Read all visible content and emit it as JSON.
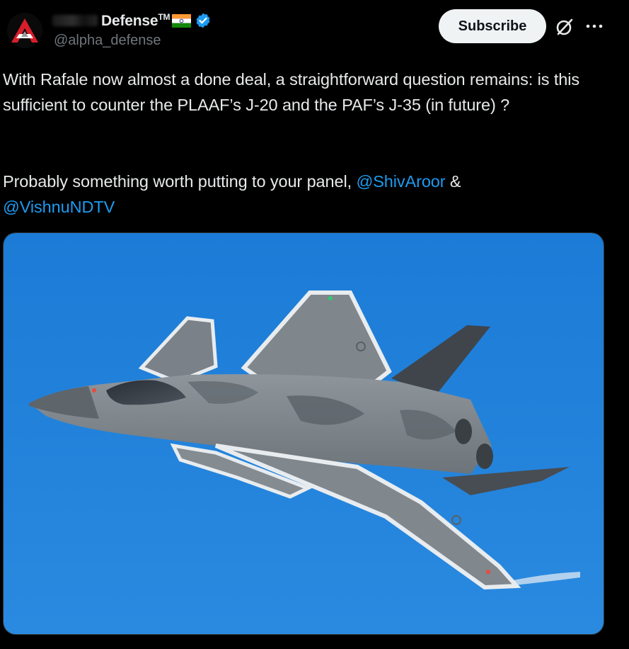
{
  "post": {
    "author": {
      "display_name": "Defense",
      "trademark": "TM",
      "handle": "@alpha_defense",
      "avatar_icon": "alpha-defense-logo-icon",
      "flag_icon": "india-flag-icon",
      "verified_icon": "verified-badge-icon",
      "verified_color": "#1d9bf0"
    },
    "actions": {
      "subscribe_label": "Subscribe",
      "grok_icon": "grok-icon",
      "more_icon": "more-options-icon"
    },
    "text": {
      "paragraph1": "With Rafale now almost a done deal, a straightforward question remains: is this sufficient to counter the PLAAF’s J-20 and the PAF’s J-35 (in future) ?",
      "paragraph2_prefix": "Probably something worth putting to your panel, ",
      "mention1": "@ShivAroor",
      "connector": " & ",
      "mention2": "@VishnuNDTV"
    },
    "media": {
      "kind": "photo",
      "subject": "stealth-fighter-jet",
      "sky_color": "#1f80d8"
    },
    "colors": {
      "background": "#000000",
      "text": "#e7e9ea",
      "secondary_text": "#71767b",
      "link": "#1d9bf0",
      "button_bg": "#eff3f4"
    }
  }
}
